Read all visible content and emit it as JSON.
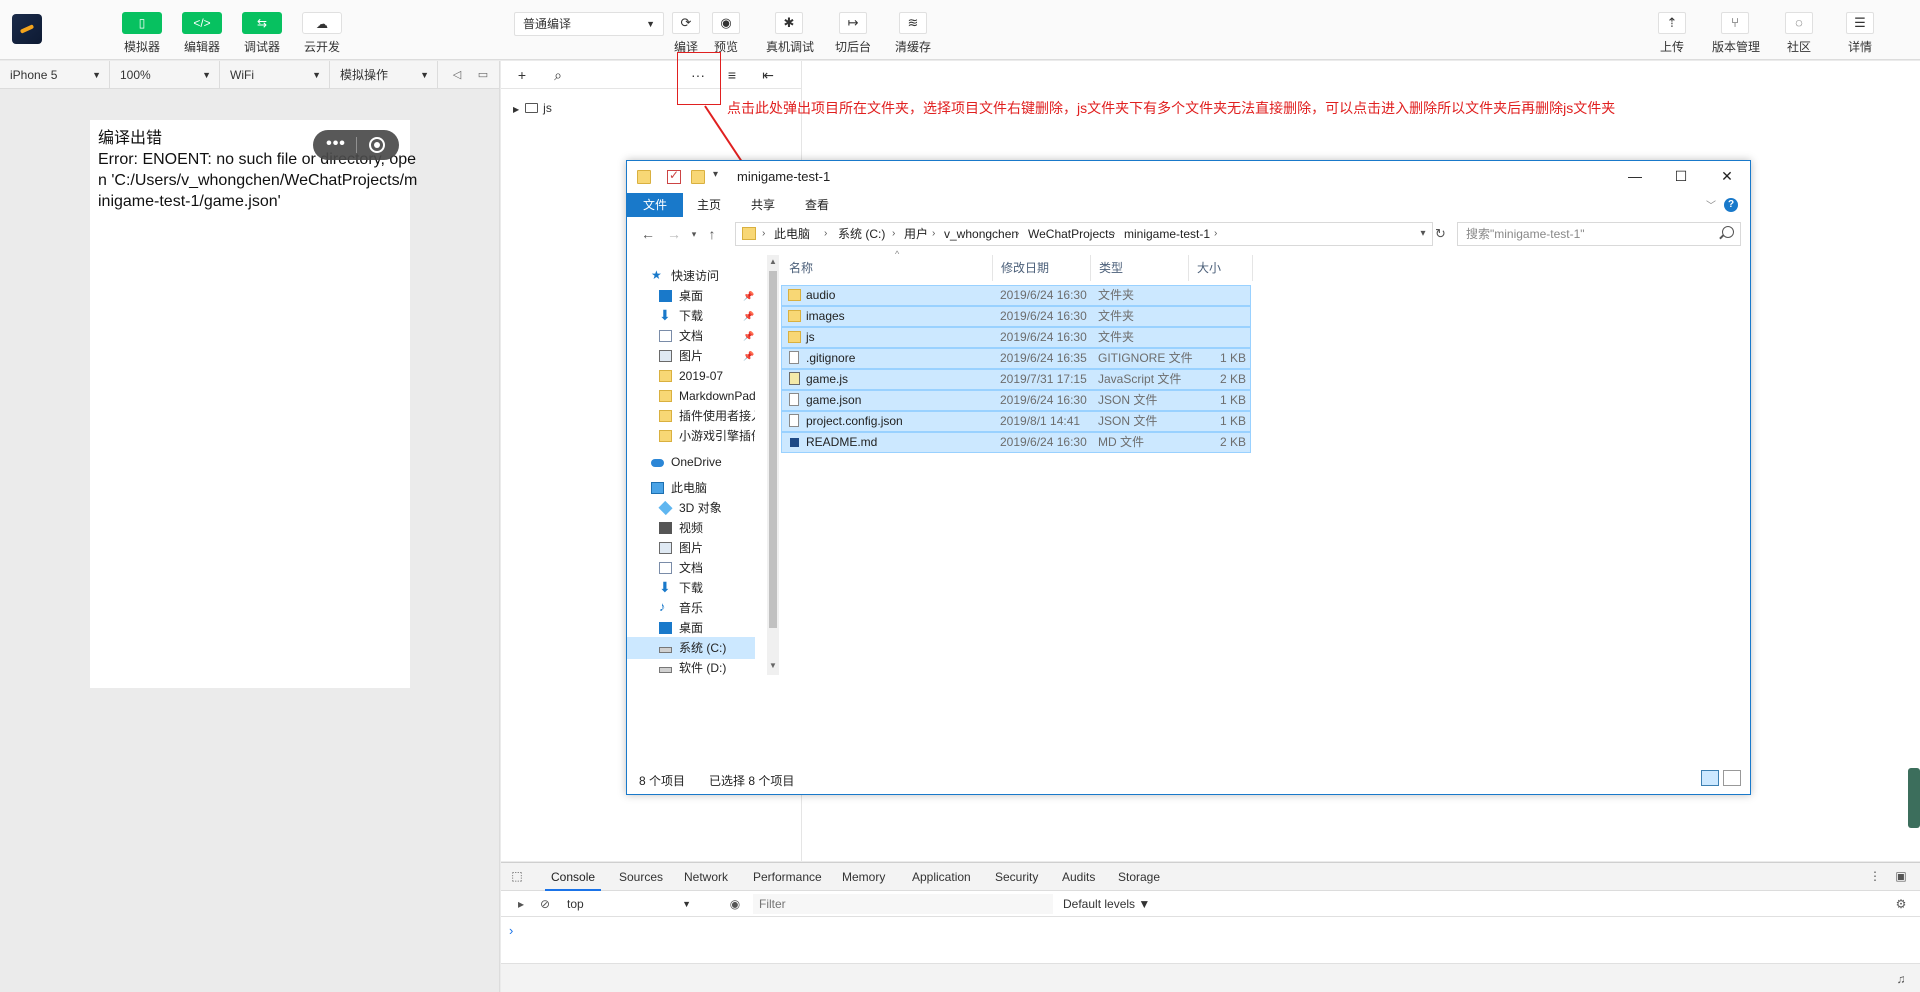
{
  "toolbar": {
    "simulator": "模拟器",
    "editor": "编辑器",
    "debugger": "调试器",
    "cloud": "云开发",
    "compile_mode": "普通编译",
    "compile": "编译",
    "preview": "预览",
    "real_debug": "真机调试",
    "background": "切后台",
    "clear_cache": "清缓存",
    "upload": "上传",
    "version": "版本管理",
    "community": "社区",
    "details": "详情",
    "editor_icon_glyph": "</>",
    "debugger_icon_glyph": "⇆"
  },
  "simbar": {
    "device": "iPhone 5",
    "zoom": "100%",
    "network": "WiFi",
    "operation": "模拟操作"
  },
  "simulator": {
    "error_text": "编译出错\nError: ENOENT: no such file or directory, open 'C:/Users/v_whongchen/WeChatProjects/minigame-test-1/game.json'",
    "capsule_dots": "•••"
  },
  "editor": {
    "tree_root": "js",
    "more_glyph": "···"
  },
  "annotation": "点击此处弹出项目所在文件夹，选择项目文件右键删除，js文件夹下有多个文件夹无法直接删除，可以点击进入删除所以文件夹后再删除js文件夹",
  "explorer": {
    "title": "minigame-test-1",
    "ribbon_tabs": [
      "文件",
      "主页",
      "共享",
      "查看"
    ],
    "help": "?",
    "breadcrumbs": [
      "此电脑",
      "系统 (C:)",
      "用户",
      "v_whongchen",
      "WeChatProjects",
      "minigame-test-1"
    ],
    "search_placeholder": "搜索\"minigame-test-1\"",
    "nav_items": [
      {
        "label": "快速访问",
        "icon": "star-icon"
      },
      {
        "label": "桌面",
        "icon": "desktop-icon"
      },
      {
        "label": "下载",
        "icon": "download-icon"
      },
      {
        "label": "文档",
        "icon": "document-icon"
      },
      {
        "label": "图片",
        "icon": "picture-icon"
      },
      {
        "label": "2019-07",
        "icon": "folder-icon"
      },
      {
        "label": "MarkdownPad",
        "icon": "folder-icon"
      },
      {
        "label": "插件使用者接入",
        "icon": "folder-icon"
      },
      {
        "label": "小游戏引擎插件",
        "icon": "folder-icon"
      },
      {
        "label": "OneDrive",
        "icon": "cloud-icon"
      },
      {
        "label": "此电脑",
        "icon": "computer-icon"
      },
      {
        "label": "3D 对象",
        "icon": "cube-icon"
      },
      {
        "label": "视频",
        "icon": "video-icon"
      },
      {
        "label": "图片",
        "icon": "picture-icon"
      },
      {
        "label": "文档",
        "icon": "document-icon"
      },
      {
        "label": "下载",
        "icon": "download-icon"
      },
      {
        "label": "音乐",
        "icon": "music-icon"
      },
      {
        "label": "桌面",
        "icon": "desktop-icon"
      },
      {
        "label": "系统 (C:)",
        "icon": "drive-icon"
      },
      {
        "label": "软件 (D:)",
        "icon": "drive-icon"
      }
    ],
    "columns": [
      "名称",
      "修改日期",
      "类型",
      "大小"
    ],
    "files": [
      {
        "name": "audio",
        "date": "2019/6/24 16:30",
        "type": "文件夹",
        "size": "",
        "icon": "folder"
      },
      {
        "name": "images",
        "date": "2019/6/24 16:30",
        "type": "文件夹",
        "size": "",
        "icon": "folder"
      },
      {
        "name": "js",
        "date": "2019/6/24 16:30",
        "type": "文件夹",
        "size": "",
        "icon": "folder"
      },
      {
        "name": ".gitignore",
        "date": "2019/6/24 16:35",
        "type": "GITIGNORE 文件",
        "size": "1 KB",
        "icon": "file"
      },
      {
        "name": "game.js",
        "date": "2019/7/31 17:15",
        "type": "JavaScript 文件",
        "size": "2 KB",
        "icon": "js"
      },
      {
        "name": "game.json",
        "date": "2019/6/24 16:30",
        "type": "JSON 文件",
        "size": "1 KB",
        "icon": "file"
      },
      {
        "name": "project.config.json",
        "date": "2019/8/1 14:41",
        "type": "JSON 文件",
        "size": "1 KB",
        "icon": "file"
      },
      {
        "name": "README.md",
        "date": "2019/6/24 16:30",
        "type": "MD 文件",
        "size": "2 KB",
        "icon": "md"
      }
    ],
    "status_count": "8 个项目",
    "status_selected": "已选择 8 个项目"
  },
  "devtools": {
    "tabs": [
      "Console",
      "Sources",
      "Network",
      "Performance",
      "Memory",
      "Application",
      "Security",
      "Audits",
      "Storage"
    ],
    "context": "top",
    "filter_placeholder": "Filter",
    "levels": "Default levels ▼",
    "prompt": "›"
  },
  "colors": {
    "brand_green": "#07c160",
    "annotation_red": "#e02020",
    "explorer_blue": "#1979ca",
    "selection": "#cce8ff"
  }
}
